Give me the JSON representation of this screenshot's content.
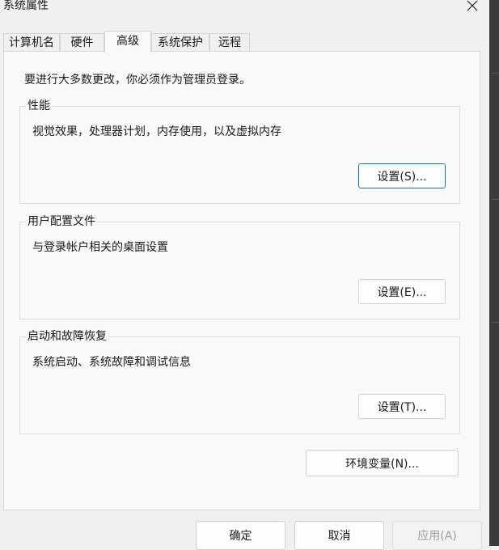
{
  "window": {
    "title": "系统属性",
    "close_icon": "close-icon"
  },
  "tabs": [
    {
      "label": "计算机名",
      "active": false
    },
    {
      "label": "硬件",
      "active": false
    },
    {
      "label": "高级",
      "active": true
    },
    {
      "label": "系统保护",
      "active": false
    },
    {
      "label": "远程",
      "active": false
    }
  ],
  "advanced": {
    "admin_note": "要进行大多数更改，你必须作为管理员登录。",
    "performance": {
      "title": "性能",
      "description": "视觉效果，处理器计划，内存使用，以及虚拟内存",
      "button": "设置(S)..."
    },
    "user_profiles": {
      "title": "用户配置文件",
      "description": "与登录帐户相关的桌面设置",
      "button": "设置(E)..."
    },
    "startup_recovery": {
      "title": "启动和故障恢复",
      "description": "系统启动、系统故障和调试信息",
      "button": "设置(T)..."
    },
    "env_button": "环境变量(N)..."
  },
  "footer": {
    "ok": "确定",
    "cancel": "取消",
    "apply": "应用(A)"
  },
  "colors": {
    "focus_border": "#1f6fb2",
    "panel_bg": "#f9f9f9",
    "window_bg": "#f0f0f0",
    "disabled_text": "#9c9c9c"
  }
}
